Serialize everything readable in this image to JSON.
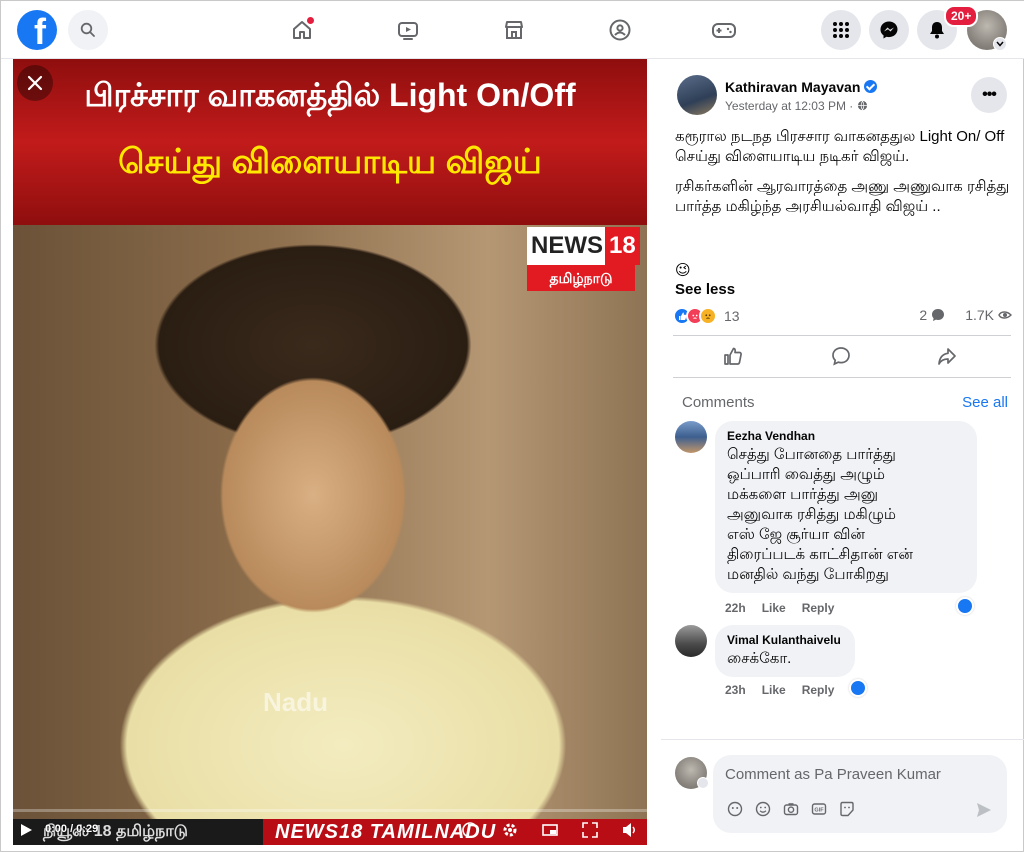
{
  "nav": {
    "logo_letter": "f",
    "notifications_badge": "20+"
  },
  "video": {
    "banner_line1": "பிரச்சார வாகனத்தில் Light On/Off",
    "banner_line2": "செய்து விளையாடிய விஜய்",
    "watermark": "Nadu",
    "logo_main": "NEWS",
    "logo_num": "18",
    "logo_sub": "தமிழ்நாடு",
    "ticker_left": "நியூஸ் 18 தமிழ்நாடு",
    "ticker_right": "NEWS18 TAMILNADU",
    "time": "0:00 / 0:29",
    "progress": 0.0
  },
  "post": {
    "author": "Kathiravan Mayavan",
    "timestamp": "Yesterday at 12:03 PM · ",
    "more": "•••",
    "paragraph1": "கரூரால நடநத பிரசசார வாகனததுல Light On/ Off செய்து விளையாடிய நடிகர் விஜய்.",
    "paragraph2": "ரசிகர்களின் ஆரவாரத்தை அணு அணுவாக ரசித்து பார்த்த மகிழ்ந்த அரசியல்வாதி விஜய் ..",
    "emoji": "😉",
    "see_less": "See less",
    "reaction_count": "13",
    "comments_count": "2",
    "shares_count": "1.7K"
  },
  "comments_section": {
    "label": "Comments",
    "see_all": "See all",
    "items": [
      {
        "name": "Eezha Vendhan",
        "text": "செத்து போனதை பார்த்து\nஒப்பாரி வைத்து அழும்\nமக்களை பார்த்து அனு\nஅனுவாக ரசித்து மகிழும்\nஎஸ் ஜே சூர்யா வின்\nதிரைப்படக் காட்சிதான் என்\nமனதில் வந்து போகிறது",
        "time": "22h",
        "like": "Like",
        "reply": "Reply"
      },
      {
        "name": "Vimal Kulanthaivelu",
        "text": "சைக்கோ.",
        "time": "23h",
        "like": "Like",
        "reply": "Reply"
      }
    ],
    "input_placeholder": "Comment as Pa Praveen Kumar"
  },
  "colors": {
    "brand": "#1877f2",
    "badge": "#e41e3f",
    "banner_red": "#c21b1b",
    "banner_yellow": "#ffe800"
  }
}
